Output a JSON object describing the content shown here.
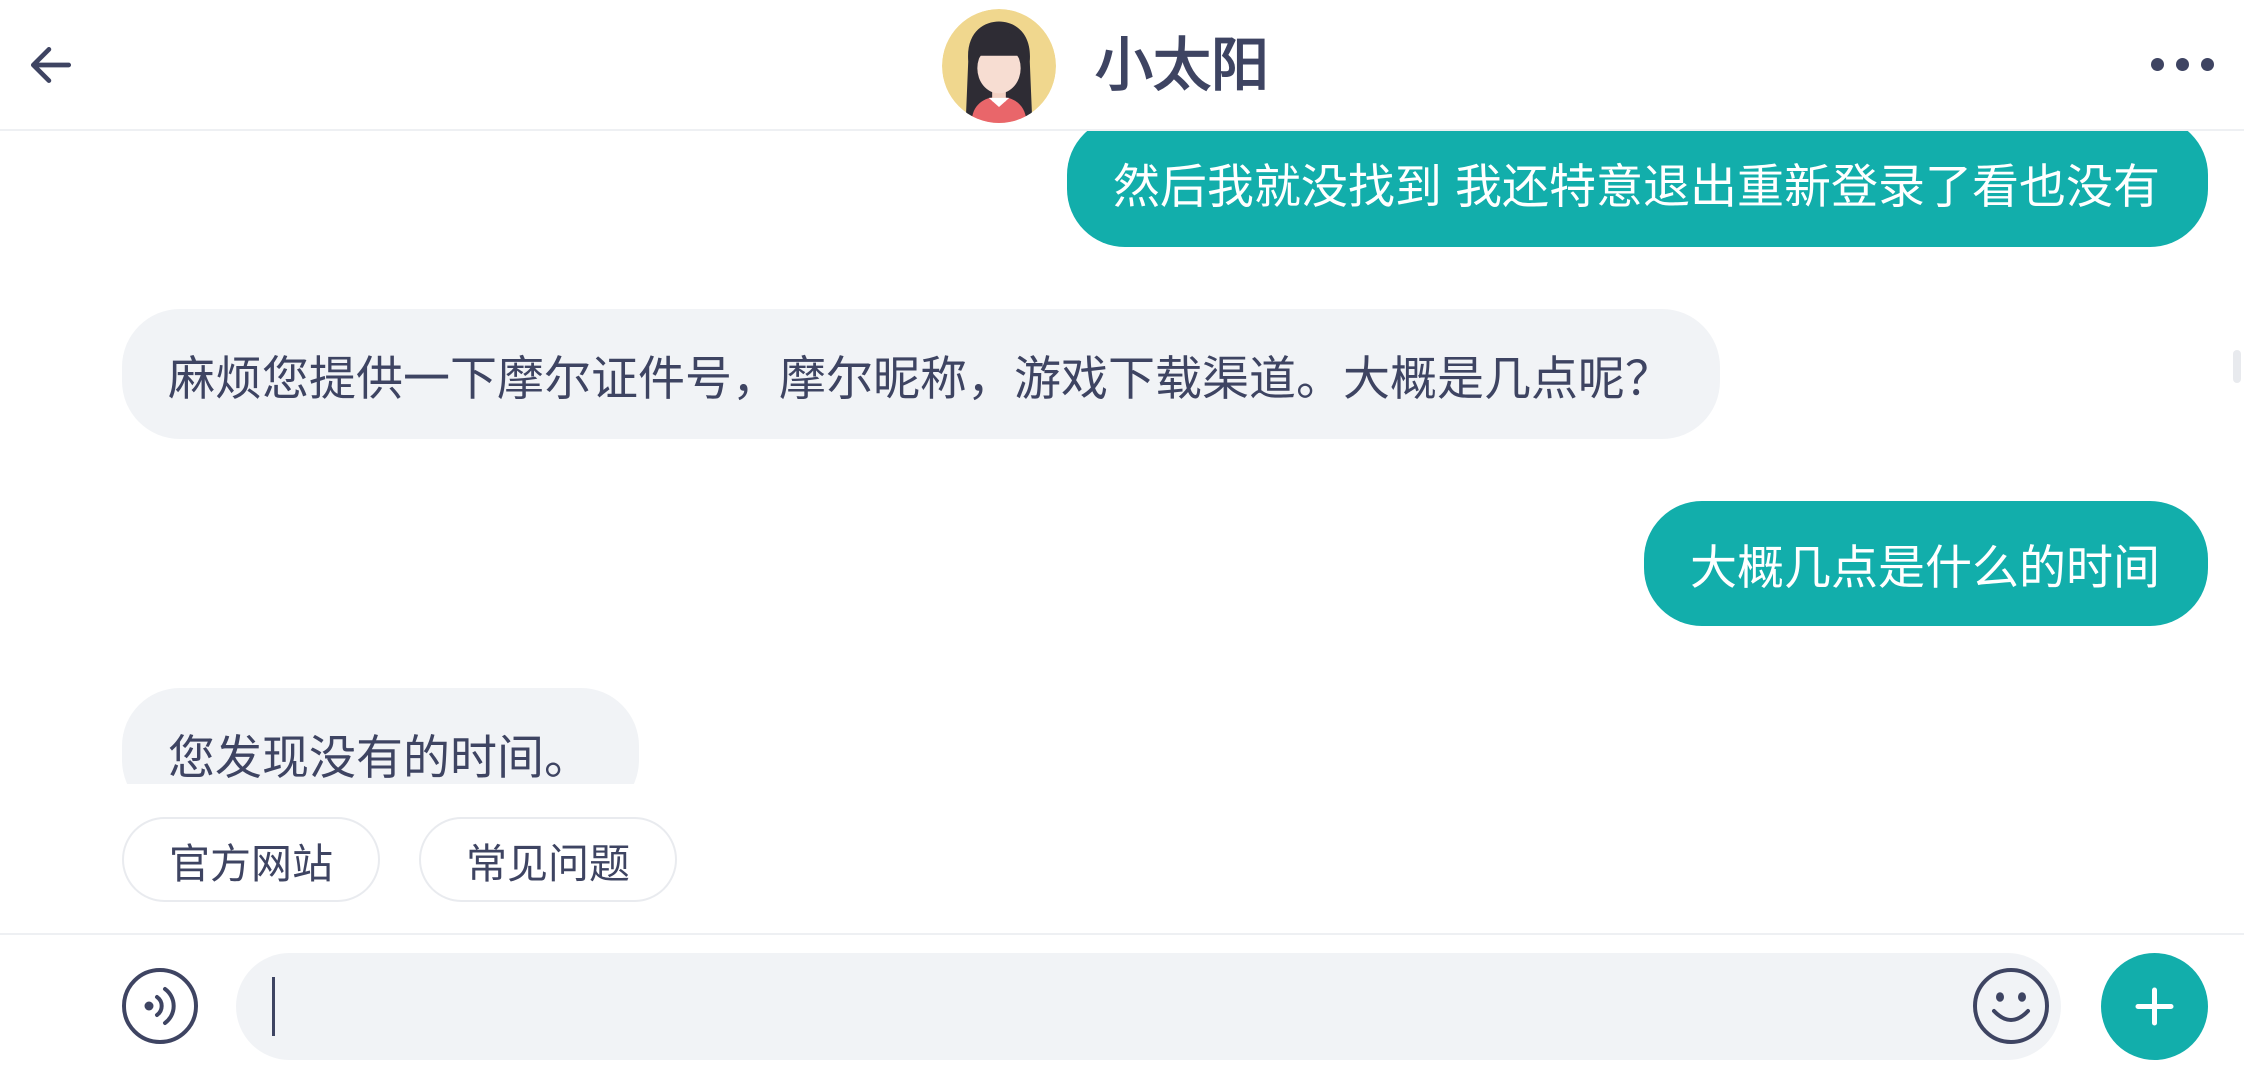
{
  "header": {
    "title": "小太阳",
    "back_icon": "arrow-left-icon",
    "more_icon": "more-horizontal-icon",
    "avatar_icon": "girl-avatar"
  },
  "messages": [
    {
      "outgoing": true,
      "text": "然后我就没找到 我还特意退出重新登录了看也没有"
    },
    {
      "outgoing": false,
      "text": "麻烦您提供一下摩尔证件号，摩尔昵称，游戏下载渠道。大概是几点呢？"
    },
    {
      "outgoing": true,
      "text": "大概几点是什么的时间"
    },
    {
      "outgoing": false,
      "text": "您发现没有的时间。"
    }
  ],
  "quick_replies": [
    {
      "label": "官方网站"
    },
    {
      "label": "常见问题"
    }
  ],
  "composer": {
    "value": "",
    "voice_icon": "voice-icon",
    "emoji_icon": "emoji-icon",
    "add_icon": "plus-icon"
  },
  "colors": {
    "accent": "#12aeab",
    "incoming_bubble": "#f1f3f6",
    "text": "#3e4462",
    "outgoing_text": "#ffffff"
  }
}
